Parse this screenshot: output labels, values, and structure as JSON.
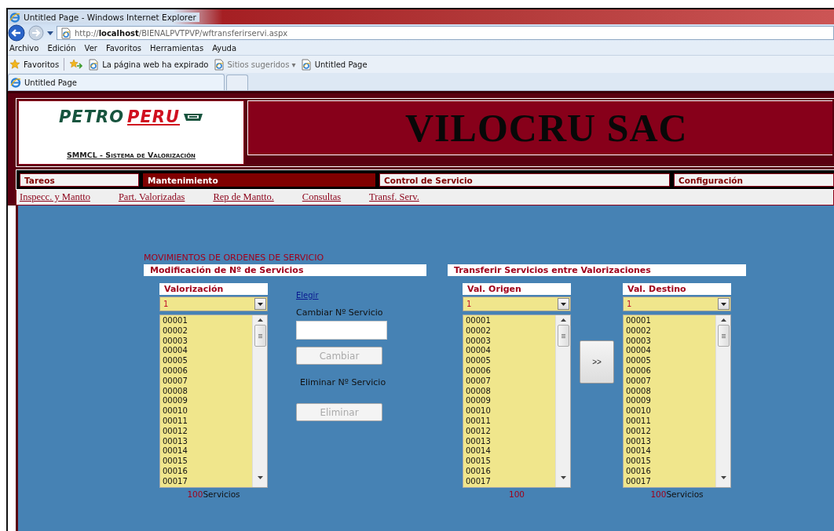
{
  "browser": {
    "title": "Untitled Page - Windows Internet Explorer",
    "url": {
      "prefix": "http://",
      "host": "localhost",
      "path": "/BIENALPVTPVP/wftransferirservi.aspx"
    },
    "menu": [
      "Archivo",
      "Edición",
      "Ver",
      "Favoritos",
      "Herramientas",
      "Ayuda"
    ],
    "favorites_bar": [
      {
        "label": "Favoritos",
        "kind": "star"
      },
      {
        "label": "La página web ha expirado",
        "kind": "page"
      },
      {
        "label": "Sitios sugeridos ▾",
        "kind": "suggested"
      },
      {
        "label": "Untitled Page",
        "kind": "page"
      }
    ],
    "tabs": [
      {
        "label": "Untitled Page",
        "selected": true
      }
    ]
  },
  "header": {
    "logo": {
      "part_1": "PETRO",
      "part_2": "PERU"
    },
    "subtitle": "SMMCL - Sistema de Valorización",
    "banner": "VILOCRU SAC"
  },
  "nav_tabs": [
    {
      "label": "Tareos",
      "selected": false
    },
    {
      "label": "Mantenimiento",
      "selected": true
    },
    {
      "label": "Control de Servicio",
      "selected": false
    },
    {
      "label": "Configuración",
      "selected": false
    }
  ],
  "submenu": [
    "Inspecc. y Mantto",
    "Part. Valorizadas",
    "Rep de Mantto.",
    "Consultas",
    "Transf. Serv."
  ],
  "content": {
    "title": "MOVIMIENTOS DE ORDENES DE SERVICIO",
    "left_section": {
      "title": "Modificación de Nº de Servicios",
      "list": {
        "label": "Valorización",
        "value": "1",
        "items": [
          "00001",
          "00002",
          "00003",
          "00004",
          "00005",
          "00006",
          "00007",
          "00008",
          "00009",
          "00010",
          "00011",
          "00012",
          "00013",
          "00014",
          "00015",
          "00016",
          "00017"
        ],
        "count": "100",
        "count_label": "Servicios"
      }
    },
    "middle": {
      "link": "Elegir",
      "change_label": "Cambiar Nº Servicio",
      "change_button": {
        "label": "Cambiar",
        "disabled": true
      },
      "delete_label": "Eliminar Nº Servicio",
      "delete_button": {
        "label": "Eliminar",
        "disabled": true
      }
    },
    "right_section": {
      "title": "Transferir Servicios entre Valorizaciones",
      "origin": {
        "label": "Val. Origen",
        "value": "1",
        "items": [
          "00001",
          "00002",
          "00003",
          "00004",
          "00005",
          "00006",
          "00007",
          "00008",
          "00009",
          "00010",
          "00011",
          "00012",
          "00013",
          "00014",
          "00015",
          "00016",
          "00017"
        ],
        "count": "100"
      },
      "transfer_button": ">>",
      "destination": {
        "label": "Val. Destino",
        "value": "1",
        "items": [
          "00001",
          "00002",
          "00003",
          "00004",
          "00005",
          "00006",
          "00007",
          "00008",
          "00009",
          "00010",
          "00011",
          "00012",
          "00013",
          "00014",
          "00015",
          "00016",
          "00017"
        ],
        "count": "100",
        "count_label": "Servicios"
      }
    }
  }
}
